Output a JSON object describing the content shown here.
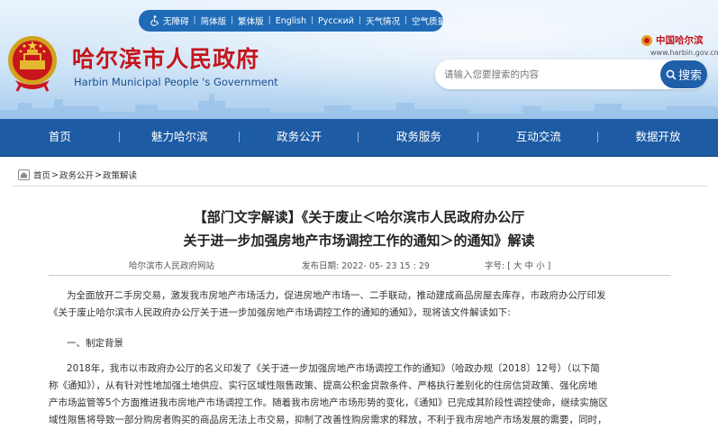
{
  "topbar": {
    "items": [
      "无障碍",
      "简体版",
      "繁体版",
      "English",
      "Русский",
      "天气情况",
      "空气质量"
    ]
  },
  "header": {
    "title": "哈尔滨市人民政府",
    "subtitle": "Harbin Municipal People 's Government",
    "china_logo_text": "中国哈尔滨",
    "china_logo_url": "www.harbin.gov.cn"
  },
  "search": {
    "placeholder": "请输入您要搜索的内容",
    "button_label": "搜索"
  },
  "nav": {
    "items": [
      "首页",
      "魅力哈尔滨",
      "政务公开",
      "政务服务",
      "互动交流",
      "数据开放"
    ]
  },
  "breadcrumb": {
    "items": [
      "首页",
      "政务公开",
      "政策解读"
    ],
    "separator": ">"
  },
  "article": {
    "title_line1": "【部门文字解读】《关于废止＜哈尔滨市人民政府办公厅",
    "title_line2": "关于进一步加强房地产市场调控工作的通知＞的通知》解读",
    "source": "哈尔滨市人民政府网站",
    "date_label": "发布日期:",
    "date_value": "2022- 05- 23  15 : 29",
    "font_size_label": "字号:",
    "font_size_open": "[",
    "font_size_large": "大",
    "font_size_medium": "中",
    "font_size_small": "小",
    "font_size_close": "]",
    "p1_line1": "为全面放开二手房交易，激发我市房地产市场活力，促进房地产市场一、二手联动，推动建成商品房屋去库存，市政府办公厅印发",
    "p1_line2": "《关于废止哈尔滨市人民政府办公厅关于进一步加强房地产市场调控工作的通知的通知》，现将该文件解读如下:",
    "section1": "一、制定背景",
    "p2_line1": "2018年，我市以市政府办公厅的名义印发了《关于进一步加强房地产市场调控工作的通知》（哈政办规〔2018〕12号）（以下简",
    "p2_line2": "称《通知》），从有针对性地加强土地供应、实行区域性限售政策、提高公积金贷款条件、严格执行差别化的住房信贷政策、强化房地",
    "p2_line3": "产市场监管等5个方面推进我市房地产市场调控工作。随着我市房地产市场形势的变化，《通知》已完成其阶段性调控使命，继续实施区",
    "p2_line4": "域性限售将导致一部分购房者购买的商品房无法上市交易，抑制了改善性购房需求的释放，不利于我市房地产市场发展的需要，同时，"
  },
  "colors": {
    "topbar": "#1f6bb7",
    "nav": "#1d5ba4",
    "title_red": "#c4161c",
    "search_button": "#1f5ea8"
  }
}
